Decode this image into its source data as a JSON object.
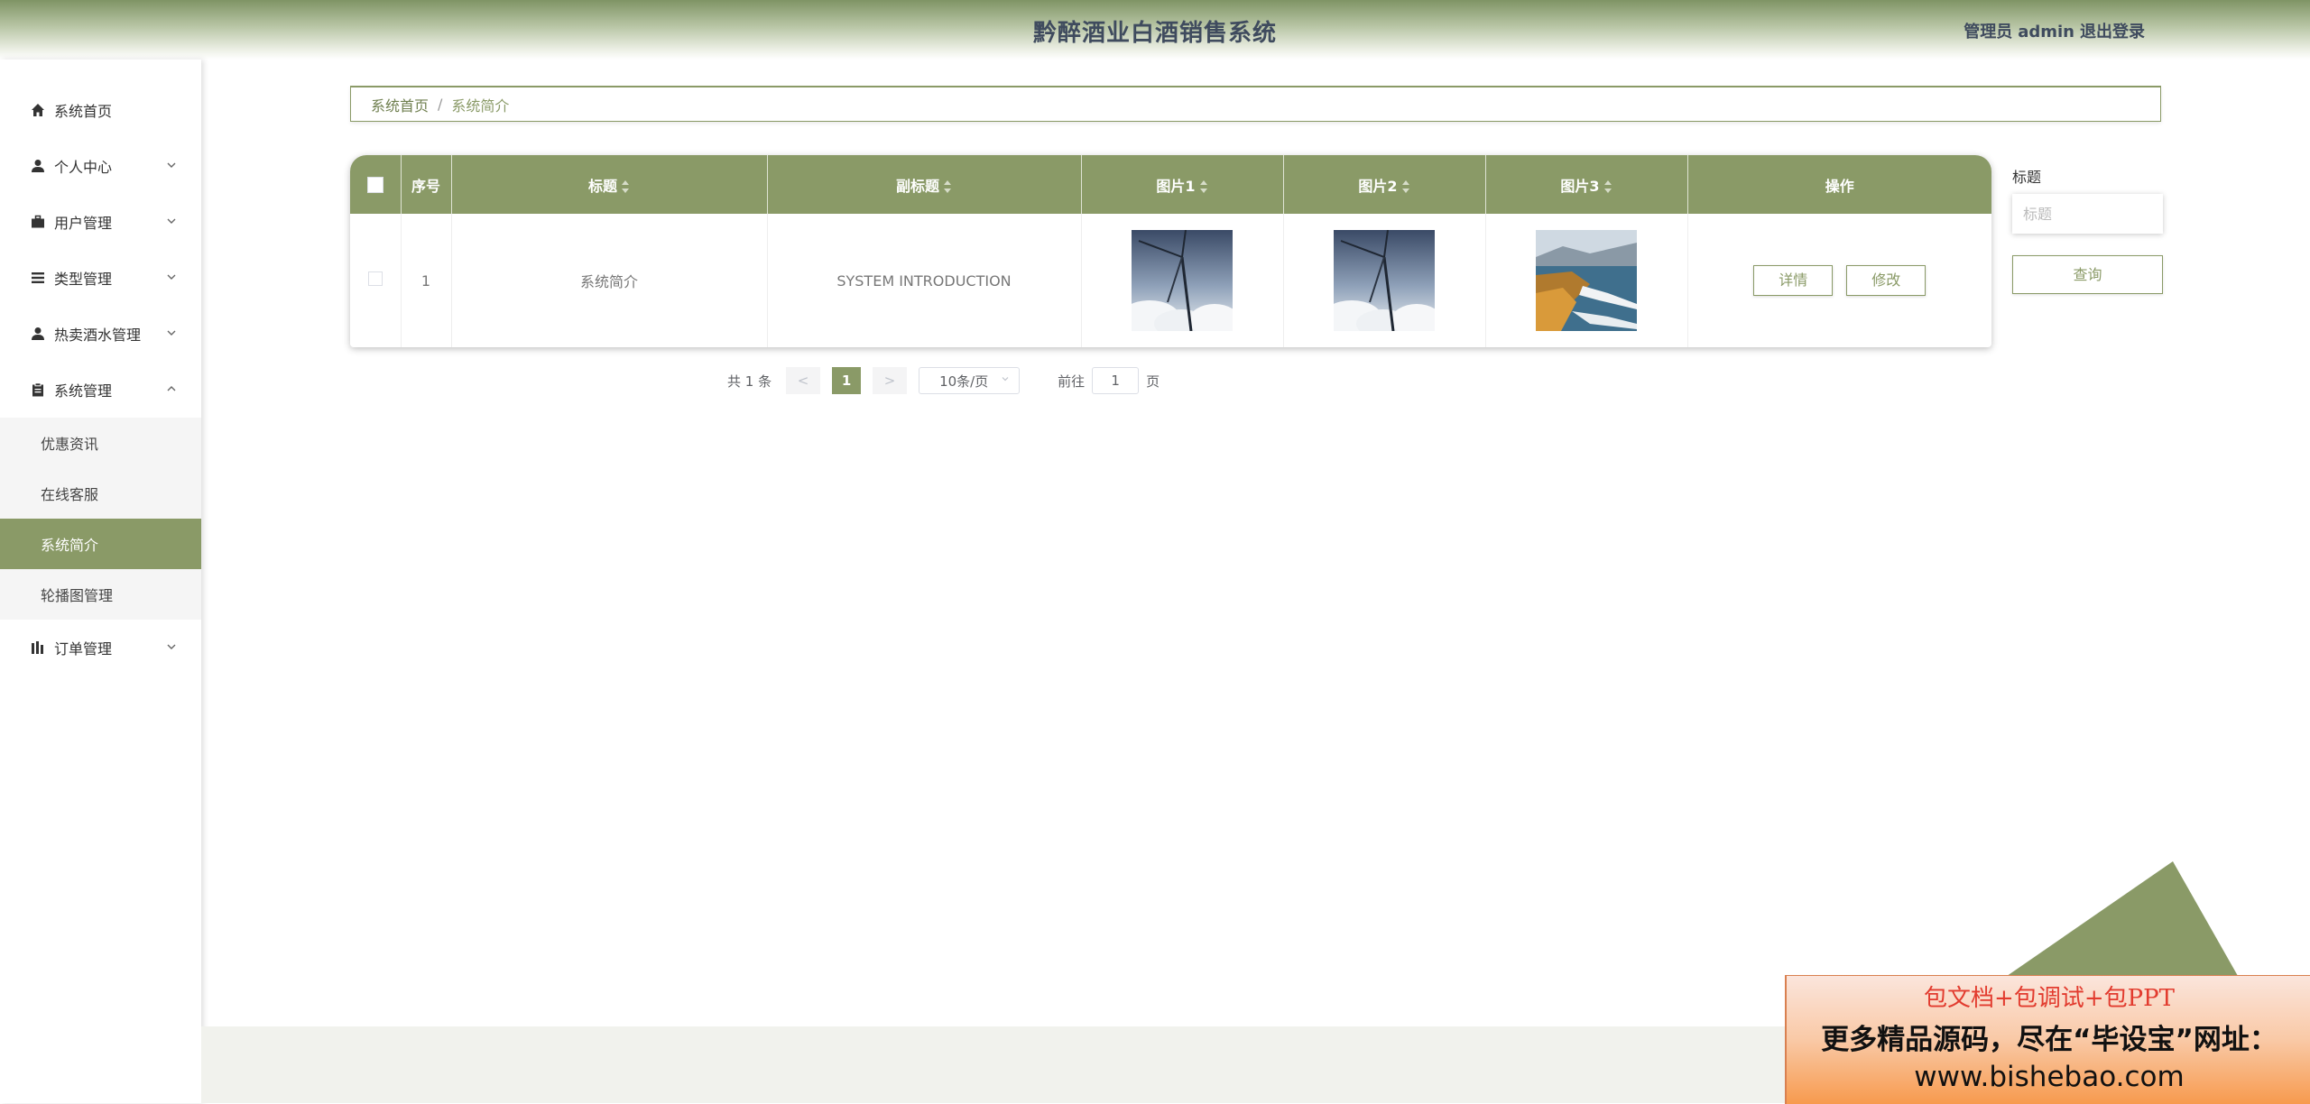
{
  "header": {
    "title": "黔醉酒业白酒销售系统",
    "role": "管理员",
    "username": "admin",
    "logout": "退出登录"
  },
  "theme": {
    "accent": "#8a9a67",
    "header_text": "#3f4b5e"
  },
  "sidebar": {
    "items": [
      {
        "label": "系统首页",
        "icon": "home-icon"
      },
      {
        "label": "个人中心",
        "icon": "user-icon"
      },
      {
        "label": "用户管理",
        "icon": "briefcase-icon"
      },
      {
        "label": "类型管理",
        "icon": "list-icon"
      },
      {
        "label": "热卖酒水管理",
        "icon": "user-icon"
      },
      {
        "label": "系统管理",
        "icon": "clipboard-icon"
      },
      {
        "label": "订单管理",
        "icon": "chart-icon"
      }
    ],
    "system_submenu": [
      {
        "label": "优惠资讯"
      },
      {
        "label": "在线客服"
      },
      {
        "label": "系统简介"
      },
      {
        "label": "轮播图管理"
      }
    ]
  },
  "breadcrumb": {
    "home": "系统首页",
    "separator": "/",
    "current": "系统简介"
  },
  "table": {
    "columns": [
      "序号",
      "标题",
      "副标题",
      "图片1",
      "图片2",
      "图片3",
      "操作"
    ],
    "rows": [
      {
        "index": "1",
        "title": "系统简介",
        "subtitle": "SYSTEM INTRODUCTION",
        "image1": "wind-turbine-image",
        "image2": "wind-turbine-image",
        "image3": "coastline-image",
        "actions": {
          "detail": "详情",
          "edit": "修改"
        }
      }
    ]
  },
  "search": {
    "label": "标题",
    "placeholder": "标题",
    "value": "",
    "button": "查询"
  },
  "pagination": {
    "total": "共 1 条",
    "prev": "<",
    "current_page": "1",
    "next": ">",
    "page_size": "10条/页",
    "goto_prefix": "前往",
    "goto_value": "1",
    "goto_suffix": "页"
  },
  "promo": {
    "line1": "包文档+包调试+包PPT",
    "line2": "更多精品源码，尽在“毕设宝”网址：",
    "line3": "www.bishebao.com"
  }
}
